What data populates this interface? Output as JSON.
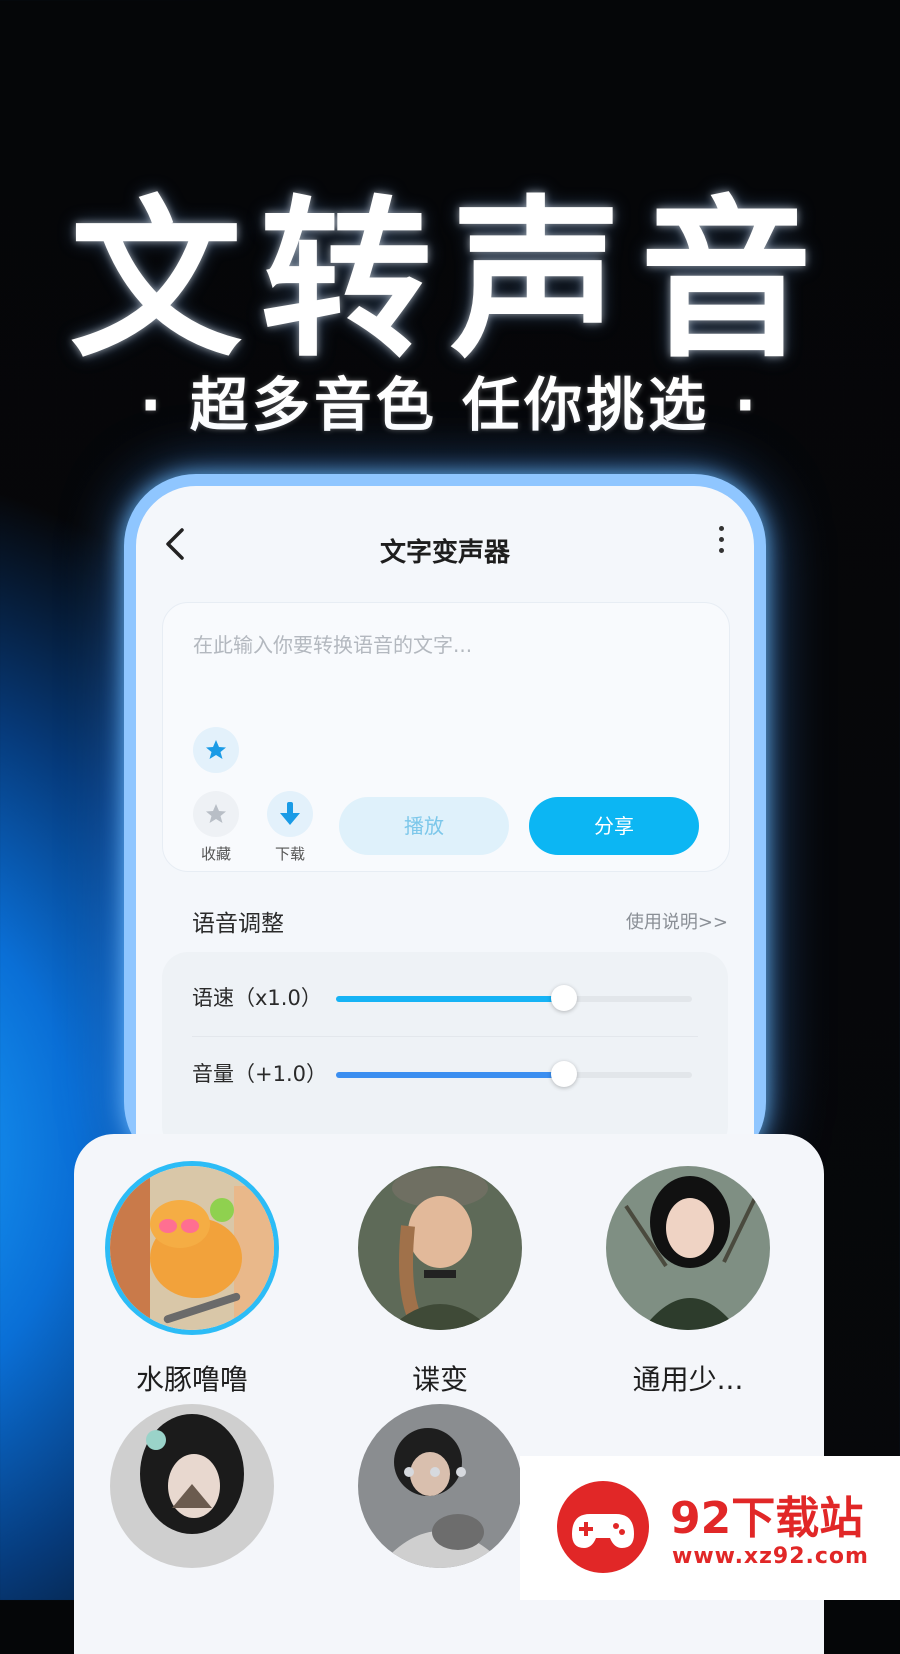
{
  "headline": "文转声音",
  "subheadline": "· 超多音色  任你挑选 ·",
  "app": {
    "title": "文字变声器",
    "input_placeholder": "在此输入你要转换语音的文字...",
    "actions": {
      "favorite_label": "收藏",
      "download_label": "下载",
      "play_label": "播放",
      "share_label": "分享"
    },
    "section_title": "语音调整",
    "section_link": "使用说明>>",
    "sliders": [
      {
        "label": "语速（x1.0）",
        "value": 0.64
      },
      {
        "label": "音量（+1.0）",
        "value": 0.64
      }
    ]
  },
  "voices": [
    {
      "name": "水豚噜噜",
      "selected": true
    },
    {
      "name": "谍变",
      "selected": false
    },
    {
      "name": "通用少...",
      "selected": false
    },
    {
      "name": "",
      "selected": false
    },
    {
      "name": "",
      "selected": false
    }
  ],
  "watermark": {
    "title": "92下载站",
    "url": "www.xz92.com"
  },
  "colors": {
    "accent": "#0cb6f3",
    "watermark": "#e12727"
  }
}
